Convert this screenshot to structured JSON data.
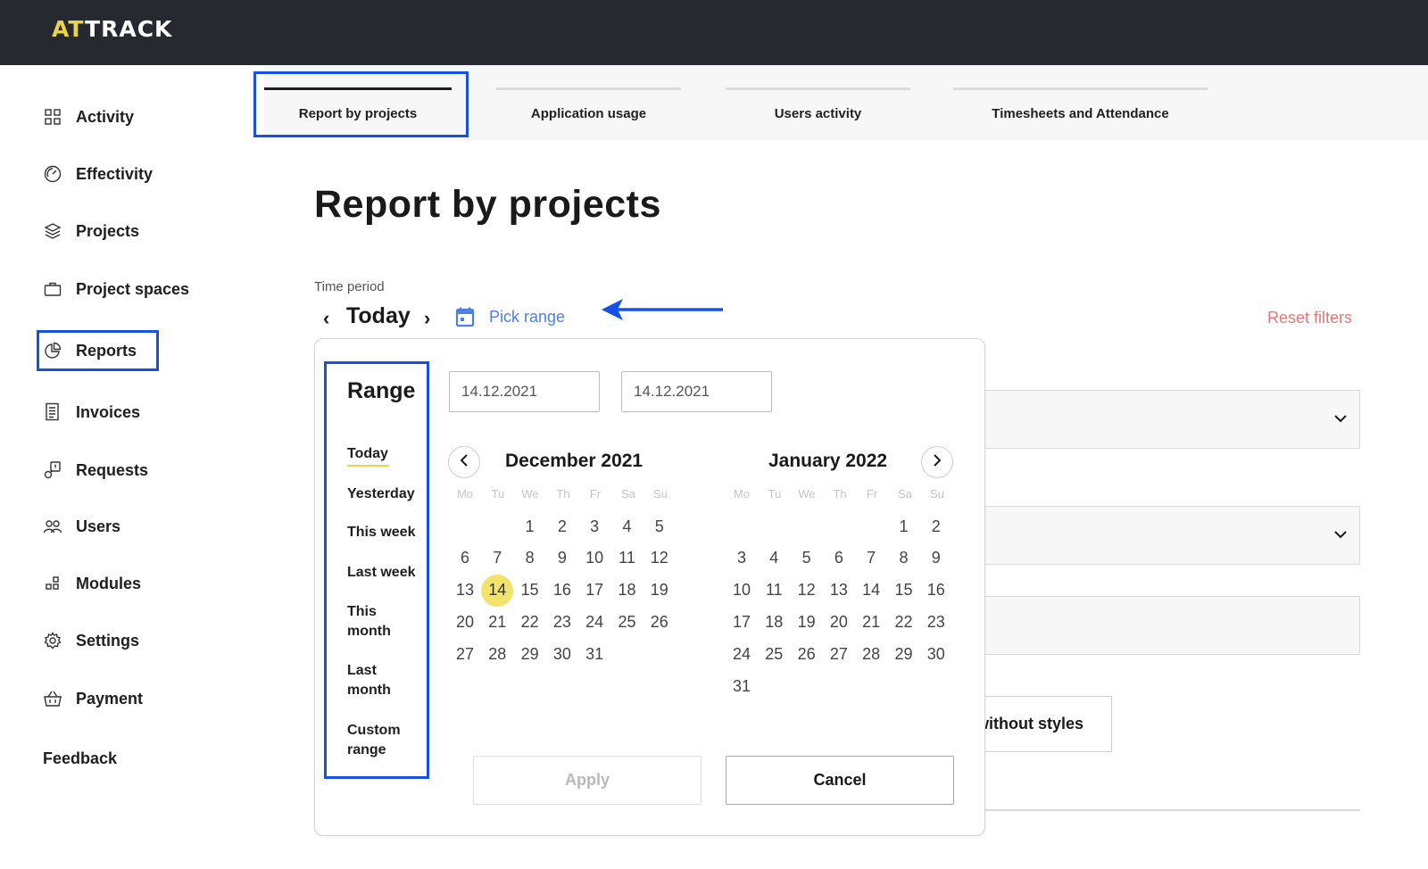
{
  "app": {
    "logo_prefix": "AT",
    "logo_suffix": "TRACK",
    "accent": "#e8d44a",
    "highlight_color": "#1650e6"
  },
  "sidebar": {
    "items": [
      {
        "label": "Activity",
        "icon": "grid-icon"
      },
      {
        "label": "Effectivity",
        "icon": "gauge-icon"
      },
      {
        "label": "Projects",
        "icon": "layers-icon"
      },
      {
        "label": "Project spaces",
        "icon": "briefcase-icon"
      },
      {
        "label": "Reports",
        "icon": "pie-chart-icon"
      },
      {
        "label": "Invoices",
        "icon": "document-icon"
      },
      {
        "label": "Requests",
        "icon": "request-icon"
      },
      {
        "label": "Users",
        "icon": "users-icon"
      },
      {
        "label": "Modules",
        "icon": "modules-icon"
      },
      {
        "label": "Settings",
        "icon": "gear-icon"
      },
      {
        "label": "Payment",
        "icon": "basket-icon"
      }
    ],
    "feedback": "Feedback"
  },
  "tabs": [
    {
      "label": "Report by projects",
      "active": true
    },
    {
      "label": "Application usage",
      "active": false
    },
    {
      "label": "Users activity",
      "active": false
    },
    {
      "label": "Timesheets and Attendance",
      "active": false
    }
  ],
  "page": {
    "title": "Report by projects",
    "time_period_label": "Time period",
    "current_period": "Today",
    "pick_range": "Pick range",
    "reset_filters": "Reset filters",
    "background_button": "without styles"
  },
  "picker": {
    "range_title": "Range",
    "ranges": [
      "Today",
      "Yesterday",
      "This week",
      "Last week",
      "This month",
      "Last month",
      "Custom range"
    ],
    "from": "14.12.2021",
    "to": "14.12.2021",
    "weekdays": [
      "Mo",
      "Tu",
      "We",
      "Th",
      "Fr",
      "Sa",
      "Su"
    ],
    "left_month": {
      "title": "December 2021",
      "selected": "14"
    },
    "right_month": {
      "title": "January 2022"
    },
    "apply": "Apply",
    "cancel": "Cancel"
  }
}
